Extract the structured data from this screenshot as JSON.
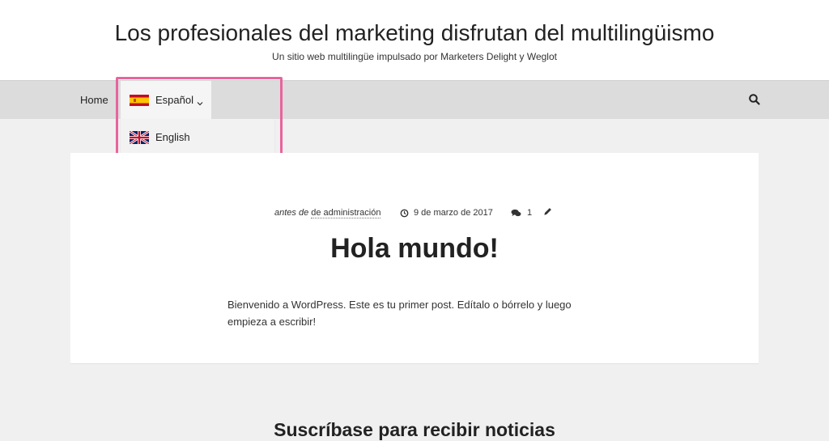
{
  "header": {
    "site_title": "Los profesionales del marketing disfrutan del multilingüismo",
    "tagline": "Un sitio web multilingüe impulsado por Marketers Delight y Weglot"
  },
  "nav": {
    "home_label": "Home",
    "current_language": {
      "label": "Español",
      "flag_icon": "spain-flag-icon"
    },
    "dropdown_languages": [
      {
        "label": "English",
        "flag_icon": "uk-flag-icon"
      }
    ],
    "search_icon": "search-icon"
  },
  "post": {
    "meta": {
      "by_text": "antes de",
      "author": "de administración",
      "date": "9 de marzo de 2017",
      "comments_count": "1"
    },
    "title": "Hola mundo!",
    "body": "Bienvenido a WordPress. Este es tu primer post. Edítalo o bórrelo y luego empieza a escribir!"
  },
  "subscribe": {
    "heading": "Suscríbase para recibir noticias"
  },
  "colors": {
    "highlight": "#e9639c",
    "dropdown_accent": "#9b1c24",
    "nav_background": "#dcdcdc",
    "page_background": "#f0f0f0"
  }
}
